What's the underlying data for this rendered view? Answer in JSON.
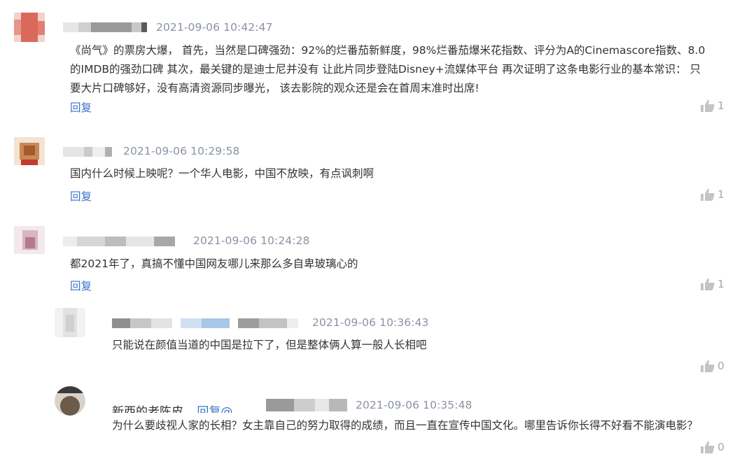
{
  "comments": [
    {
      "time": "2021-09-06 10:42:47",
      "lines": [
        "《尚气》的票房大爆， 首先，当然是口碑强劲：92%的烂番茄新鲜度，98%烂番茄爆米花指数、评分为A的Cinemascore指数、8.0",
        "的IMDB的强劲口碑 其次，最关键的是迪士尼并没有 让此片同步登陆Disney+流媒体平台 再次证明了这条电影行业的基本常识： 只",
        "要大片口碑够好，没有高清资源同步曝光， 该去影院的观众还是会在首周末准时出席!"
      ],
      "reply_label": "回复",
      "likes": "1"
    },
    {
      "time": "2021-09-06 10:29:58",
      "lines": [
        "国内什么时候上映呢？一个华人电影，中国不放映，有点讽刺啊"
      ],
      "reply_label": "回复",
      "likes": "1"
    },
    {
      "time": "2021-09-06 10:24:28",
      "lines": [
        "都2021年了，真搞不懂中国网友哪儿来那么多自卑玻璃心的"
      ],
      "reply_label": "回复",
      "likes": "1"
    }
  ],
  "replies": [
    {
      "time": "2021-09-06 10:36:43",
      "text": "只能说在颜值当道的中国是拉下了，但是整体俩人算一般人长相吧",
      "likes": "0"
    },
    {
      "head_user": "新西的老陈皮",
      "head_at": "回复@",
      "time": "2021-09-06 10:35:48",
      "text": "为什么要歧视人家的长相？女主靠自己的努力取得的成绩，而且一直在宣传中国文化。哪里告诉你长得不好看不能演电影？",
      "likes": "0"
    }
  ],
  "colors": {
    "link": "#3a74c9",
    "timestamp": "#8a93a3",
    "text": "#333333",
    "like": "#a8a8a8"
  },
  "icons": {
    "like": "thumbs-up-icon",
    "avatar": "avatar-icon"
  }
}
